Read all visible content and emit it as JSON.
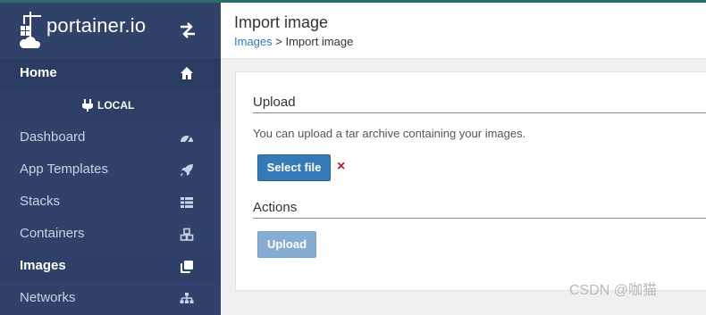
{
  "brand": {
    "name": "portainer.io"
  },
  "sidebar": {
    "home": {
      "label": "Home",
      "icon": "home-icon"
    },
    "endpoint": {
      "label": "LOCAL",
      "icon": "plug-icon"
    },
    "items": [
      {
        "label": "Dashboard",
        "icon": "tachometer-icon"
      },
      {
        "label": "App Templates",
        "icon": "rocket-icon"
      },
      {
        "label": "Stacks",
        "icon": "th-list-icon"
      },
      {
        "label": "Containers",
        "icon": "cubes-icon"
      },
      {
        "label": "Images",
        "icon": "clone-icon",
        "active": true
      },
      {
        "label": "Networks",
        "icon": "sitemap-icon"
      }
    ]
  },
  "header": {
    "title": "Import image",
    "breadcrumb": {
      "link": "Images",
      "separator": " > ",
      "current": "Import image"
    }
  },
  "upload": {
    "section_title": "Upload",
    "help": "You can upload a tar archive containing your images.",
    "select_label": "Select file",
    "remove_symbol": "×"
  },
  "actions": {
    "section_title": "Actions",
    "upload_label": "Upload"
  },
  "watermark": "CSDN @咖猫",
  "colors": {
    "sidebar_bg": "#30426a",
    "primary": "#337ab7",
    "primary_disabled": "#86acd3",
    "danger": "#a6262b",
    "link": "#337ab7"
  }
}
